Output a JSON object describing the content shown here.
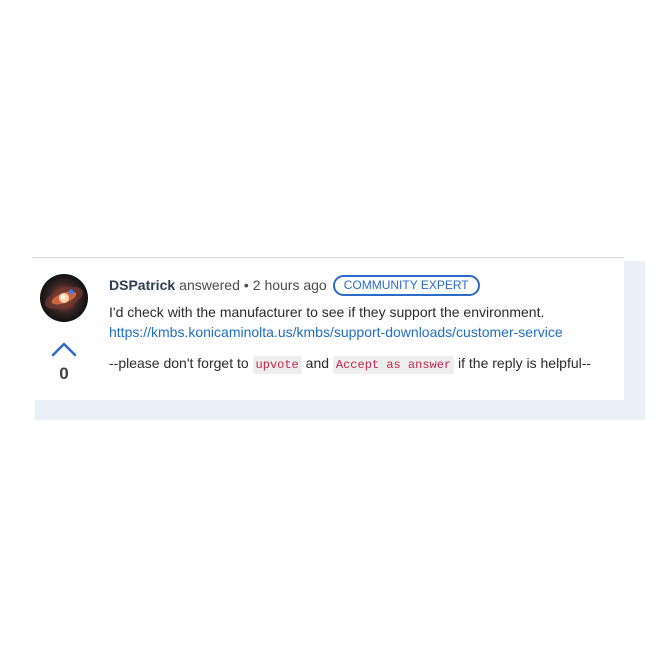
{
  "answer": {
    "author": "DSPatrick",
    "action": "answered",
    "separator": "•",
    "time": "2 hours ago",
    "badge": "COMMUNITY EXPERT",
    "text": "I'd check with the manufacturer to see if they support the environment.",
    "link": "https://kmbs.konicaminolta.us/kmbs/support-downloads/customer-service",
    "footer": {
      "prefix": "--please don't forget to",
      "code1": "upvote",
      "middle": "and",
      "code2": "Accept as answer",
      "suffix": "if the reply is helpful--"
    },
    "votes": "0"
  },
  "colors": {
    "accent": "#2b6ac8",
    "link": "#1f6ec6",
    "code_text": "#c7254e",
    "panel_bg": "#ebeff7"
  },
  "icons": {
    "upvote": "chevron-up-icon",
    "avatar": "user-avatar"
  }
}
